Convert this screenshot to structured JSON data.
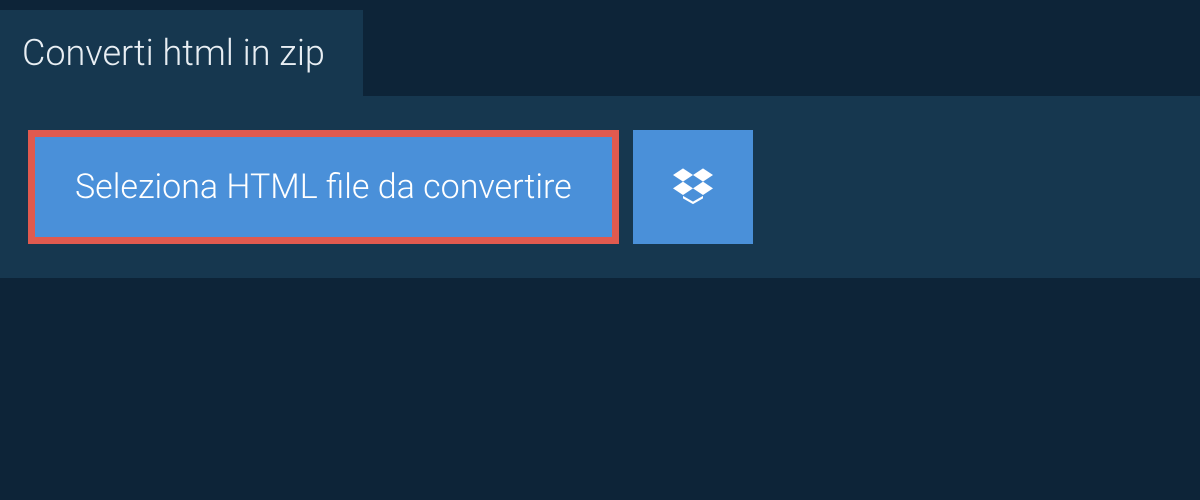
{
  "tab": {
    "label": "Converti html in zip"
  },
  "panel": {
    "selectButtonLabel": "Seleziona HTML file da convertire"
  }
}
